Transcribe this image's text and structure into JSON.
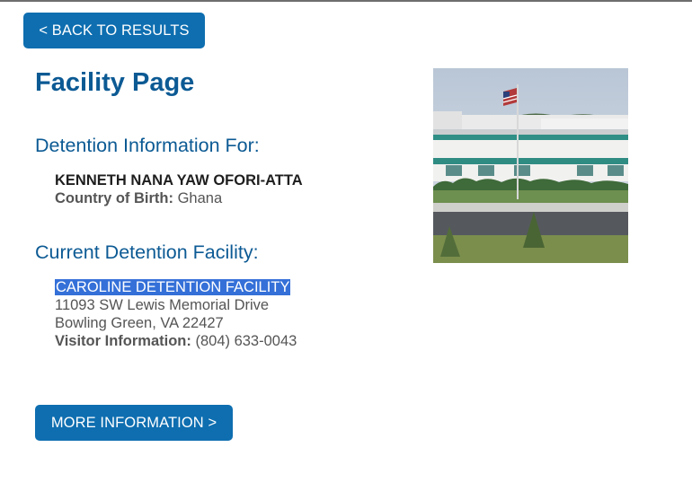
{
  "navigation": {
    "back_label": "< BACK TO RESULTS"
  },
  "page": {
    "title": "Facility Page"
  },
  "detention_info": {
    "heading": "Detention Information For:",
    "detainee_name": "KENNETH NANA YAW OFORI-ATTA",
    "country_of_birth_label": "Country of Birth:",
    "country_of_birth": "Ghana"
  },
  "facility": {
    "heading": "Current Detention Facility:",
    "name": "CAROLINE DETENTION FACILITY",
    "address_line1": "11093 SW Lewis Memorial Drive",
    "address_line2": "Bowling Green, VA 22427",
    "visitor_label": "Visitor Information:",
    "visitor_phone": "(804) 633-0043"
  },
  "actions": {
    "more_info_label": "MORE INFORMATION >"
  },
  "colors": {
    "button_bg": "#0e6eb0",
    "heading_blue": "#0c5a94",
    "selection_highlight": "#3470d8"
  }
}
